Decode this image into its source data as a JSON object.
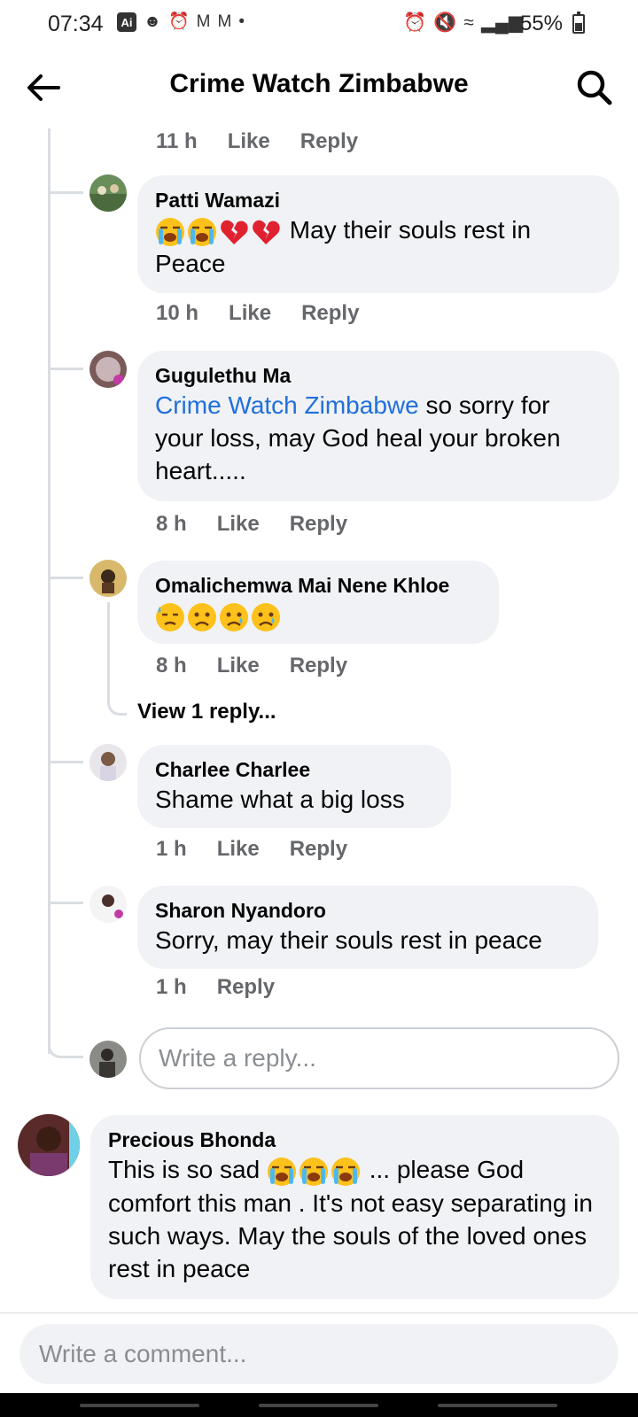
{
  "status_bar": {
    "time": "07:34",
    "ai_badge": "Ai",
    "battery": "55%",
    "battery_level": 0.55
  },
  "header": {
    "title": "Crime Watch Zimbabwe",
    "back_icon": "arrow-left-icon",
    "search_icon": "search-icon"
  },
  "prev_meta": {
    "time": "11 h",
    "like": "Like",
    "reply": "Reply"
  },
  "replies": [
    {
      "name": "Patti Wamazi",
      "emojis": [
        "loudly-crying-face",
        "loudly-crying-face",
        "broken-heart",
        "broken-heart"
      ],
      "text": " May their souls rest in Peace",
      "time": "10 h",
      "like": "Like",
      "reply": "Reply"
    },
    {
      "name": "Gugulethu Ma",
      "mention": "Crime Watch Zimbabwe",
      "text": " so sorry for your loss, may God heal your broken heart.....",
      "time": "8 h",
      "like": "Like",
      "reply": "Reply"
    },
    {
      "name": "Omalichemwa Mai Nene Khloe",
      "emojis": [
        "downcast-face-with-sweat",
        "sad-face",
        "crying-face",
        "crying-face"
      ],
      "time": "8 h",
      "like": "Like",
      "reply": "Reply",
      "view_replies": "View 1 reply..."
    },
    {
      "name": "Charlee Charlee",
      "text": "Shame what a big loss",
      "time": "1 h",
      "like": "Like",
      "reply": "Reply"
    },
    {
      "name": "Sharon Nyandoro",
      "text": "Sorry, may their souls rest in peace",
      "time": "1 h",
      "reply": "Reply"
    }
  ],
  "reply_input": {
    "placeholder": "Write a reply..."
  },
  "top_comment": {
    "name": "Precious Bhonda",
    "text_before": "This is so sad ",
    "emojis": [
      "loudly-crying-face",
      "loudly-crying-face",
      "loudly-crying-face"
    ],
    "text_after": " ... please God comfort this man . It's not easy separating in such ways. May the souls of the loved ones rest in peace"
  },
  "comment_input": {
    "placeholder": "Write a comment..."
  },
  "colors": {
    "bubble": "#f0f2f5",
    "meta_text": "#65676b",
    "mention": "#216fdb",
    "thread_line": "#dadde1"
  }
}
